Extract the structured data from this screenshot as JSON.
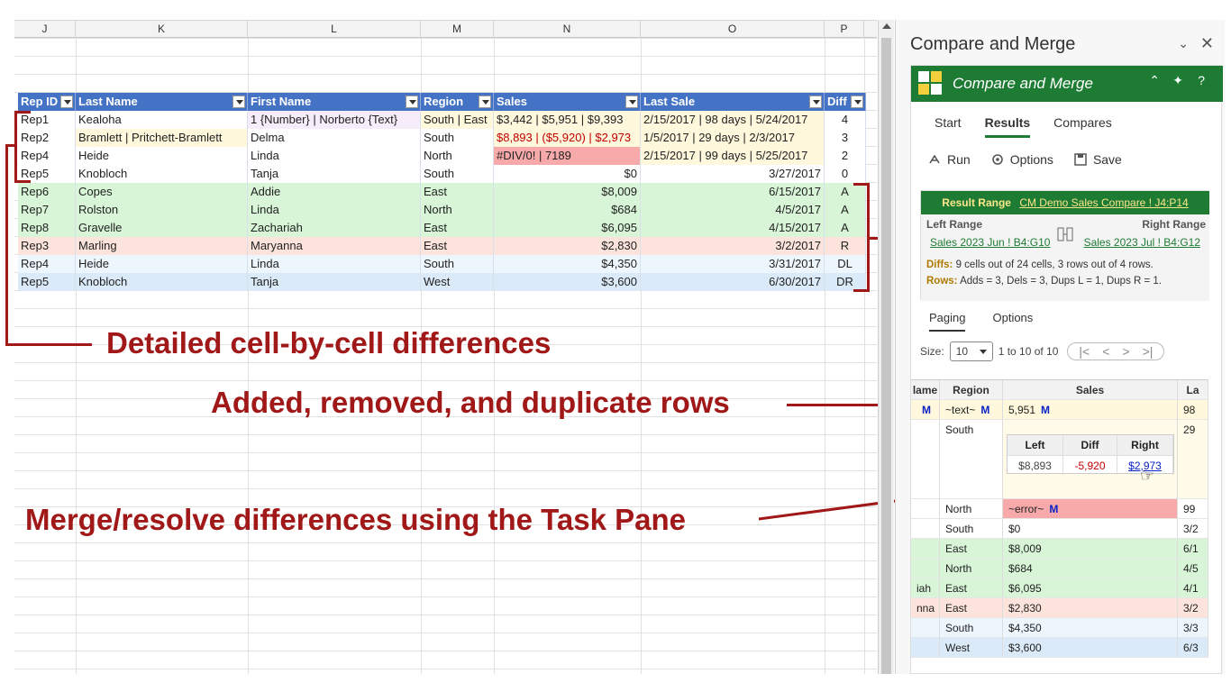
{
  "sheet": {
    "columns": [
      "J",
      "K",
      "L",
      "M",
      "N",
      "O",
      "P"
    ],
    "table": {
      "headers": [
        "Rep ID",
        "Last Name",
        "First Name",
        "Region",
        "Sales",
        "Last Sale",
        "Diff"
      ],
      "rows": [
        [
          "Rep1",
          "Kealoha",
          "1 {Number} | Norberto {Text}",
          "South | East",
          "$3,442 | $5,951 | $9,393",
          "2/15/2017 | 98 days | 5/24/2017",
          "4"
        ],
        [
          "Rep2",
          "Bramlett | Pritchett-Bramlett",
          "Delma",
          "South",
          "$8,893 | ($5,920) | $2,973",
          "1/5/2017 | 29 days | 2/3/2017",
          "3"
        ],
        [
          "Rep4",
          "Heide",
          "Linda",
          "North",
          "#DIV/0! | 7189",
          "2/15/2017 | 99 days | 5/25/2017",
          "2"
        ],
        [
          "Rep5",
          "Knobloch",
          "Tanja",
          "South",
          "$0",
          "3/27/2017",
          "0"
        ],
        [
          "Rep6",
          "Copes",
          "Addie",
          "East",
          "$8,009",
          "6/15/2017",
          "A"
        ],
        [
          "Rep7",
          "Rolston",
          "Linda",
          "North",
          "$684",
          "4/5/2017",
          "A"
        ],
        [
          "Rep8",
          "Gravelle",
          "Zachariah",
          "East",
          "$6,095",
          "4/15/2017",
          "A"
        ],
        [
          "Rep3",
          "Marling",
          "Maryanna",
          "East",
          "$2,830",
          "3/2/2017",
          "R"
        ],
        [
          "Rep4",
          "Heide",
          "Linda",
          "South",
          "$4,350",
          "3/31/2017",
          "DL"
        ],
        [
          "Rep5",
          "Knobloch",
          "Tanja",
          "West",
          "$3,600",
          "6/30/2017",
          "DR"
        ]
      ]
    },
    "annotations": {
      "cell_diffs": "Detailed cell-by-cell differences",
      "rows": "Added, removed, and duplicate rows",
      "merge": "Merge/resolve differences using the Task Pane"
    },
    "colors": {
      "annotation": "#a01818",
      "header": "#4472c4",
      "added": "#d8f5d8",
      "removed": "#fce4dc",
      "dup_left": "#eef6fd",
      "dup_right": "#dbeaf8"
    }
  },
  "pane": {
    "title": "Compare and Merge",
    "addin": {
      "title": "Compare and Merge",
      "tabs": [
        "Start",
        "Results",
        "Compares"
      ],
      "active_tab": "Results",
      "toolbar": {
        "run": "Run",
        "options": "Options",
        "save": "Save"
      },
      "result_range_label": "Result Range",
      "result_range_link": "CM Demo Sales Compare ! J4:P14",
      "left_range_label": "Left Range",
      "left_range_link": "Sales 2023 Jun ! B4:G10",
      "right_range_label": "Right Range",
      "right_range_link": "Sales 2023 Jul ! B4:G12",
      "diffs_label": "Diffs:",
      "diffs_text": "9 cells out of 24 cells, 3 rows out of 4 rows.",
      "rows_label": "Rows:",
      "rows_text": "Adds = 3, Dels = 3, Dups L = 1, Dups R = 1.",
      "paging_tabs": [
        "Paging",
        "Options"
      ],
      "size_label": "Size:",
      "size_value": "10",
      "range_text": "1 to 10 of 10",
      "grid": {
        "headers": [
          "lame",
          "Region",
          "Sales",
          "La"
        ],
        "rows": [
          [
            "M",
            "~text~",
            "5,951",
            "98"
          ],
          [
            "",
            "South",
            "",
            "29"
          ],
          [
            "",
            "North",
            "~error~",
            "99"
          ],
          [
            "",
            "South",
            "$0",
            "3/2"
          ],
          [
            "",
            "East",
            "$8,009",
            "6/1"
          ],
          [
            "",
            "North",
            "$684",
            "4/5"
          ],
          [
            "iah",
            "East",
            "$6,095",
            "4/1"
          ],
          [
            "nna",
            "East",
            "$2,830",
            "3/2"
          ],
          [
            "",
            "South",
            "$4,350",
            "3/3"
          ],
          [
            "",
            "West",
            "$3,600",
            "6/3"
          ]
        ],
        "m_marker": "M",
        "popup": {
          "headers": [
            "Left",
            "Diff",
            "Right"
          ],
          "values": [
            "$8,893",
            "-5,920",
            "$2,973"
          ]
        }
      }
    }
  }
}
